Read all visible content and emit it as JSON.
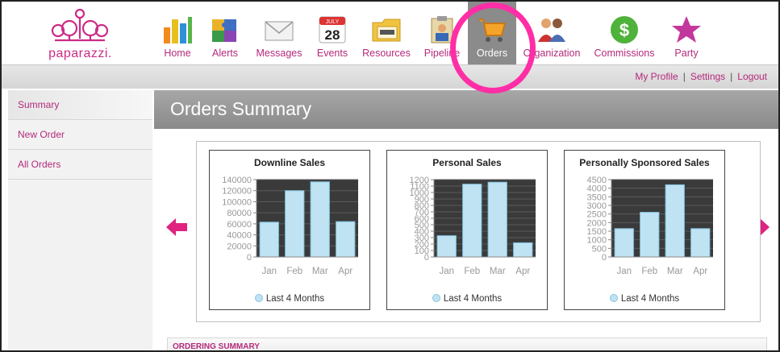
{
  "brand": {
    "name": "paparazzi."
  },
  "nav": [
    {
      "key": "home",
      "label": "Home",
      "icon": "bar-chart-icon"
    },
    {
      "key": "alerts",
      "label": "Alerts",
      "icon": "puzzle-icon"
    },
    {
      "key": "messages",
      "label": "Messages",
      "icon": "envelope-icon"
    },
    {
      "key": "events",
      "label": "Events",
      "icon": "calendar-icon",
      "icon_text": {
        "month": "JULY",
        "day": "28"
      }
    },
    {
      "key": "resources",
      "label": "Resources",
      "icon": "folder-icon"
    },
    {
      "key": "pipeline",
      "label": "Pipeline",
      "icon": "clipboard-icon"
    },
    {
      "key": "orders",
      "label": "Orders",
      "icon": "shopping-cart-icon",
      "active": true
    },
    {
      "key": "organization",
      "label": "Organization",
      "icon": "people-icon"
    },
    {
      "key": "commissions",
      "label": "Commissions",
      "icon": "dollar-icon",
      "icon_text": "$"
    },
    {
      "key": "party",
      "label": "Party",
      "icon": "star-icon"
    }
  ],
  "utility_links": {
    "profile": "My Profile",
    "settings": "Settings",
    "logout": "Logout"
  },
  "sidebar": {
    "items": [
      {
        "label": "Summary",
        "active": true
      },
      {
        "label": "New Order"
      },
      {
        "label": "All Orders"
      }
    ]
  },
  "page": {
    "title": "Orders Summary"
  },
  "ordering_summary": {
    "label": "ORDERING SUMMARY"
  },
  "colors": {
    "accent": "#b42a7b",
    "highlight": "#ff2ea6",
    "bar_fill": "#bfe3f3",
    "plot_bg": "#3a3a3a"
  },
  "chart_data": [
    {
      "type": "bar",
      "title": "Downline Sales",
      "categories": [
        "Jan",
        "Feb",
        "Mar",
        "Apr"
      ],
      "series": [
        {
          "name": "Last 4 Months",
          "values": [
            63000,
            120000,
            136000,
            64000
          ]
        }
      ],
      "ylim": [
        0,
        140000
      ],
      "yticks": [
        0,
        20000,
        40000,
        60000,
        80000,
        100000,
        120000,
        140000
      ],
      "ytick_labels": [
        "0",
        "20000",
        "40000",
        "60000",
        "80000",
        "100000",
        "120000",
        "140000"
      ],
      "grid": true,
      "legend": "bottom"
    },
    {
      "type": "bar",
      "title": "Personal Sales",
      "categories": [
        "Jan",
        "Feb",
        "Mar",
        "Apr"
      ],
      "series": [
        {
          "name": "Last 4 Months",
          "values": [
            330,
            1130,
            1160,
            220
          ]
        }
      ],
      "ylim": [
        0,
        1200
      ],
      "yticks": [
        0,
        100,
        200,
        300,
        400,
        500,
        600,
        700,
        800,
        900,
        1000,
        1100,
        1200
      ],
      "ytick_labels": [
        "0",
        "100",
        "200",
        "300",
        "400",
        "500",
        "600",
        "700",
        "800",
        "900",
        "1000",
        "1100",
        "1200"
      ],
      "grid": true,
      "legend": "bottom"
    },
    {
      "type": "bar",
      "title": "Personally Sponsored Sales",
      "categories": [
        "Jan",
        "Feb",
        "Mar",
        "Apr"
      ],
      "series": [
        {
          "name": "Last 4 Months",
          "values": [
            1650,
            2600,
            4200,
            1650
          ]
        }
      ],
      "ylim": [
        0,
        4500
      ],
      "yticks": [
        0,
        500,
        1000,
        1500,
        2000,
        2500,
        3000,
        3500,
        4000,
        4500
      ],
      "ytick_labels": [
        "0",
        "500",
        "1000",
        "1500",
        "2000",
        "2500",
        "3000",
        "3500",
        "4000",
        "4500"
      ],
      "grid": true,
      "legend": "bottom"
    }
  ]
}
